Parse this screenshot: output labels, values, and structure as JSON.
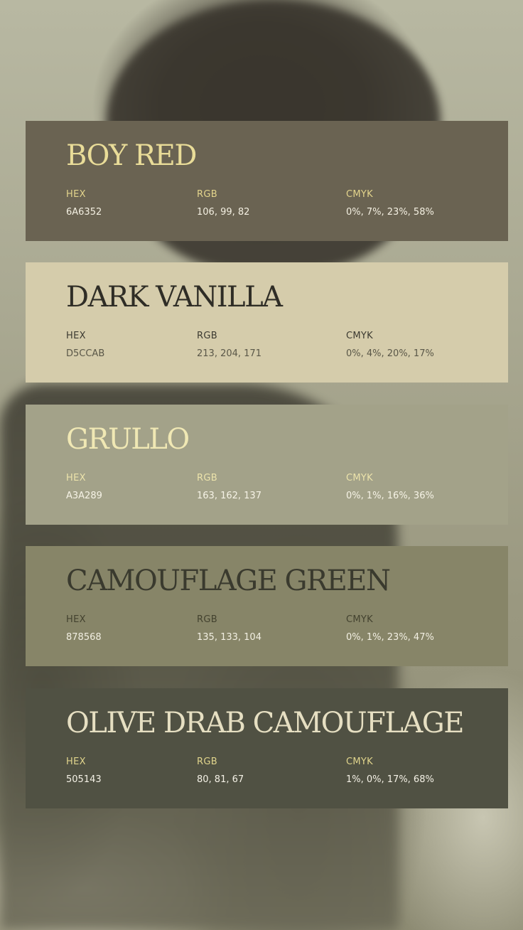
{
  "labels": {
    "hex": "HEX",
    "rgb": "RGB",
    "cmyk": "CMYK"
  },
  "swatches": [
    {
      "name": "BOY RED",
      "hex": "6A6352",
      "rgb": "106, 99, 82",
      "cmyk": "0%, 7%, 23%, 58%",
      "color": "#6a6352",
      "title_color": "#e9dc98",
      "label_color": "#e3d48c",
      "value_color": "#f4f0e2"
    },
    {
      "name": "DARK VANILLA",
      "hex": "D5CCAB",
      "rgb": "213, 204, 171",
      "cmyk": "0%, 4%, 20%, 17%",
      "color": "#d5ccab",
      "title_color": "#2f2d26",
      "label_color": "#3c3a31",
      "value_color": "#5a5748"
    },
    {
      "name": "GRULLO",
      "hex": "A3A289",
      "rgb": "163, 162, 137",
      "cmyk": "0%, 1%, 16%, 36%",
      "color": "#a3a289",
      "title_color": "#f0e8b4",
      "label_color": "#ece3ab",
      "value_color": "#f6f3e6"
    },
    {
      "name": "CAMOUFLAGE GREEN",
      "hex": "878568",
      "rgb": "135, 133, 104",
      "cmyk": "0%, 1%, 23%, 47%",
      "color": "#878568",
      "title_color": "#3a3a2e",
      "label_color": "#43422f",
      "value_color": "#f2efe2"
    },
    {
      "name": "OLIVE DRAB CAMOUFLAGE",
      "hex": "505143",
      "rgb": "80, 81, 67",
      "cmyk": "1%, 0%, 17%, 68%",
      "color": "#505143",
      "title_color": "#e6dfc2",
      "label_color": "#e0d48c",
      "value_color": "#f4f1e6"
    }
  ]
}
